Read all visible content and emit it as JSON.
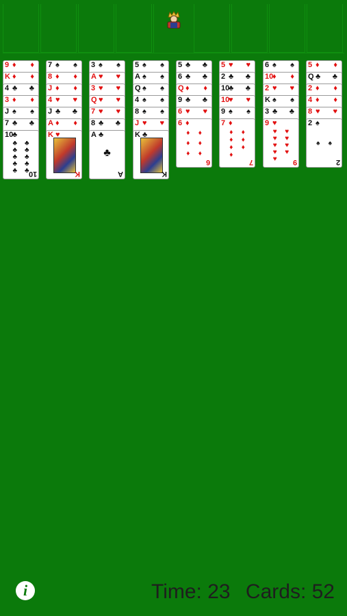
{
  "status": {
    "time_label": "Time: 23",
    "cards_label": "Cards: 52"
  },
  "icons": {
    "top_center": "king-icon",
    "info": "info-icon"
  },
  "info_glyph": "i",
  "columns": [
    {
      "cards": [
        {
          "rank": "9",
          "suit": "♦",
          "color": "red"
        },
        {
          "rank": "K",
          "suit": "♦",
          "color": "red"
        },
        {
          "rank": "4",
          "suit": "♣",
          "color": "black"
        },
        {
          "rank": "3",
          "suit": "♦",
          "color": "red"
        },
        {
          "rank": "J",
          "suit": "♠",
          "color": "black"
        },
        {
          "rank": "7",
          "suit": "♣",
          "color": "black"
        },
        {
          "rank": "10",
          "suit": "♣",
          "color": "black",
          "full": true
        }
      ]
    },
    {
      "cards": [
        {
          "rank": "7",
          "suit": "♠",
          "color": "black"
        },
        {
          "rank": "8",
          "suit": "♦",
          "color": "red"
        },
        {
          "rank": "J",
          "suit": "♦",
          "color": "red"
        },
        {
          "rank": "4",
          "suit": "♥",
          "color": "red"
        },
        {
          "rank": "J",
          "suit": "♣",
          "color": "black"
        },
        {
          "rank": "A",
          "suit": "♦",
          "color": "red"
        },
        {
          "rank": "K",
          "suit": "♥",
          "color": "red",
          "full": true,
          "face": true
        }
      ]
    },
    {
      "cards": [
        {
          "rank": "3",
          "suit": "♠",
          "color": "black"
        },
        {
          "rank": "A",
          "suit": "♥",
          "color": "red"
        },
        {
          "rank": "3",
          "suit": "♥",
          "color": "red"
        },
        {
          "rank": "Q",
          "suit": "♥",
          "color": "red"
        },
        {
          "rank": "7",
          "suit": "♥",
          "color": "red"
        },
        {
          "rank": "8",
          "suit": "♣",
          "color": "black"
        },
        {
          "rank": "A",
          "suit": "♣",
          "color": "black",
          "full": true
        }
      ]
    },
    {
      "cards": [
        {
          "rank": "5",
          "suit": "♠",
          "color": "black"
        },
        {
          "rank": "A",
          "suit": "♠",
          "color": "black"
        },
        {
          "rank": "Q",
          "suit": "♠",
          "color": "black"
        },
        {
          "rank": "4",
          "suit": "♠",
          "color": "black"
        },
        {
          "rank": "8",
          "suit": "♠",
          "color": "black"
        },
        {
          "rank": "J",
          "suit": "♥",
          "color": "red"
        },
        {
          "rank": "K",
          "suit": "♣",
          "color": "black",
          "full": true,
          "face": true
        }
      ]
    },
    {
      "cards": [
        {
          "rank": "5",
          "suit": "♣",
          "color": "black"
        },
        {
          "rank": "6",
          "suit": "♣",
          "color": "black"
        },
        {
          "rank": "Q",
          "suit": "♦",
          "color": "red"
        },
        {
          "rank": "9",
          "suit": "♣",
          "color": "black"
        },
        {
          "rank": "6",
          "suit": "♥",
          "color": "red"
        },
        {
          "rank": "6",
          "suit": "♦",
          "color": "red",
          "full": true
        }
      ]
    },
    {
      "cards": [
        {
          "rank": "5",
          "suit": "♥",
          "color": "red"
        },
        {
          "rank": "2",
          "suit": "♣",
          "color": "black"
        },
        {
          "rank": "10",
          "suit": "♣",
          "color": "black"
        },
        {
          "rank": "10",
          "suit": "♥",
          "color": "red"
        },
        {
          "rank": "9",
          "suit": "♠",
          "color": "black"
        },
        {
          "rank": "7",
          "suit": "♦",
          "color": "red",
          "full": true
        }
      ]
    },
    {
      "cards": [
        {
          "rank": "6",
          "suit": "♠",
          "color": "black"
        },
        {
          "rank": "10",
          "suit": "♦",
          "color": "red"
        },
        {
          "rank": "2",
          "suit": "♥",
          "color": "red"
        },
        {
          "rank": "K",
          "suit": "♠",
          "color": "black"
        },
        {
          "rank": "3",
          "suit": "♣",
          "color": "black"
        },
        {
          "rank": "9",
          "suit": "♥",
          "color": "red",
          "full": true
        }
      ]
    },
    {
      "cards": [
        {
          "rank": "5",
          "suit": "♦",
          "color": "red"
        },
        {
          "rank": "Q",
          "suit": "♣",
          "color": "black"
        },
        {
          "rank": "2",
          "suit": "♦",
          "color": "red"
        },
        {
          "rank": "4",
          "suit": "♦",
          "color": "red"
        },
        {
          "rank": "8",
          "suit": "♥",
          "color": "red"
        },
        {
          "rank": "2",
          "suit": "♠",
          "color": "black",
          "full": true
        }
      ]
    }
  ]
}
